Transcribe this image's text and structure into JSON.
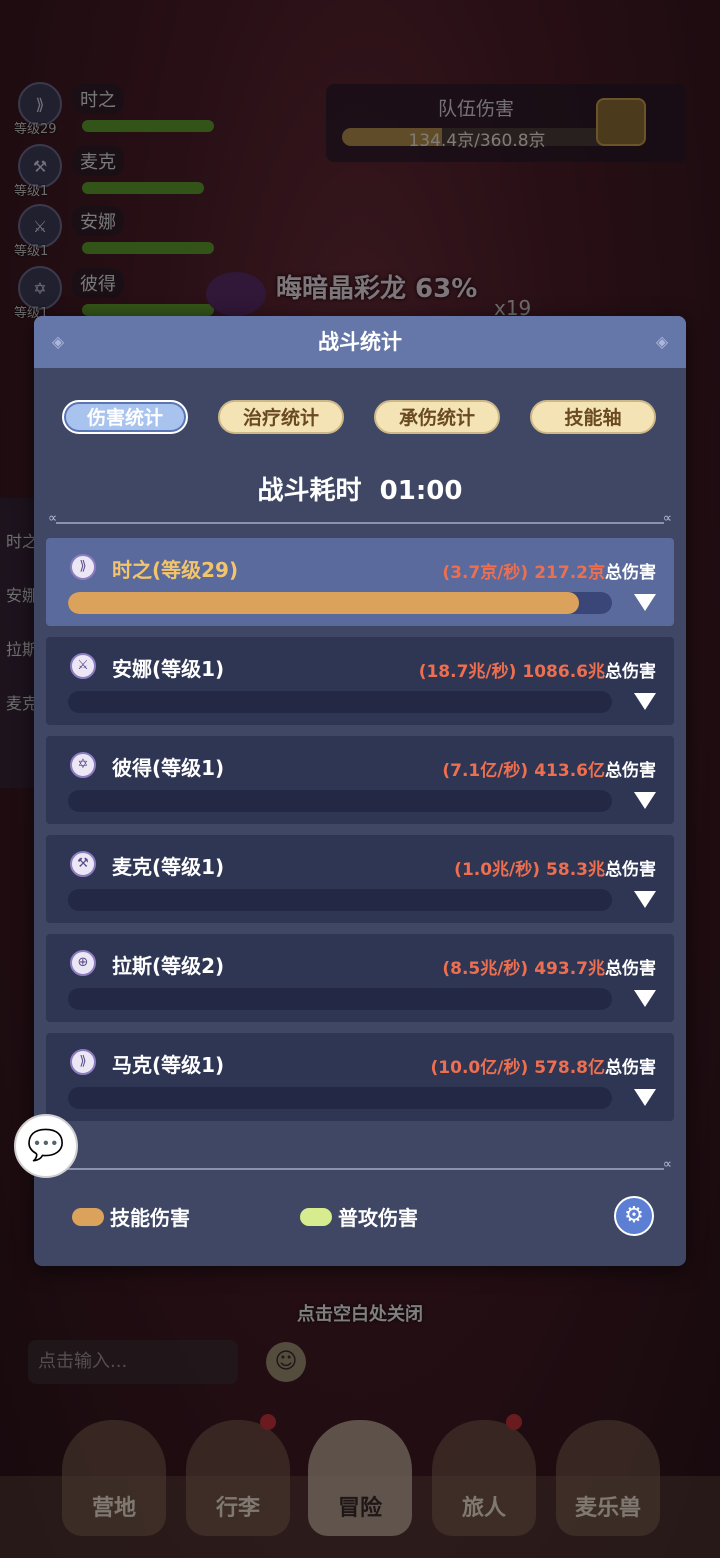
{
  "background": {
    "team_members": [
      {
        "name": "时之",
        "level": "等级29",
        "hp": 0.9
      },
      {
        "name": "麦克",
        "level": "等级1",
        "hp": 0.8
      },
      {
        "name": "安娜",
        "level": "等级1",
        "hp": 0.9
      },
      {
        "name": "彼得",
        "level": "等级1",
        "hp": 0.9
      }
    ],
    "team_damage": {
      "title": "队伍伤害",
      "value_text": "134.4京/360.8京",
      "progress": 0.372
    },
    "boss": {
      "name": "晦暗晶彩龙 63%",
      "multiplier": "x19"
    },
    "left_tabs": [
      "时之",
      "安娜",
      "拉斯",
      "麦克"
    ],
    "close_hint": "点击空白处关闭",
    "chat_input_placeholder": "点击输入...",
    "nav": [
      "营地",
      "行李",
      "冒险",
      "旅人",
      "麦乐兽"
    ],
    "nav_active": "冒险"
  },
  "modal": {
    "title": "战斗统计",
    "tabs": [
      {
        "label": "伤害统计",
        "active": true
      },
      {
        "label": "治疗统计",
        "active": false
      },
      {
        "label": "承伤统计",
        "active": false
      },
      {
        "label": "技能轴",
        "active": false
      }
    ],
    "duration_label": "战斗耗时",
    "duration_value": "01:00",
    "total_suffix": "总伤害",
    "rows": [
      {
        "name": "时之(等级29)",
        "rate": "(3.7京/秒)",
        "total": "217.2京",
        "share": 0.94,
        "highlight": true,
        "icon": "dash-class-icon"
      },
      {
        "name": "安娜(等级1)",
        "rate": "(18.7兆/秒)",
        "total": "1086.6兆",
        "share": 0,
        "highlight": false,
        "icon": "crossed-swords-icon"
      },
      {
        "name": "彼得(等级1)",
        "rate": "(7.1亿/秒)",
        "total": "413.6亿",
        "share": 0,
        "highlight": false,
        "icon": "hexagram-icon"
      },
      {
        "name": "麦克(等级1)",
        "rate": "(1.0兆/秒)",
        "total": "58.3兆",
        "share": 0,
        "highlight": false,
        "icon": "axe-icon"
      },
      {
        "name": "拉斯(等级2)",
        "rate": "(8.5兆/秒)",
        "total": "493.7兆",
        "share": 0,
        "highlight": false,
        "icon": "shield-cross-icon"
      },
      {
        "name": "马克(等级1)",
        "rate": "(10.0亿/秒)",
        "total": "578.8亿",
        "share": 0,
        "highlight": false,
        "icon": "dash-class-icon"
      }
    ],
    "legend": [
      {
        "label": "技能伤害",
        "color": "#dba25b"
      },
      {
        "label": "普攻伤害",
        "color": "#d7ec8e"
      }
    ]
  }
}
